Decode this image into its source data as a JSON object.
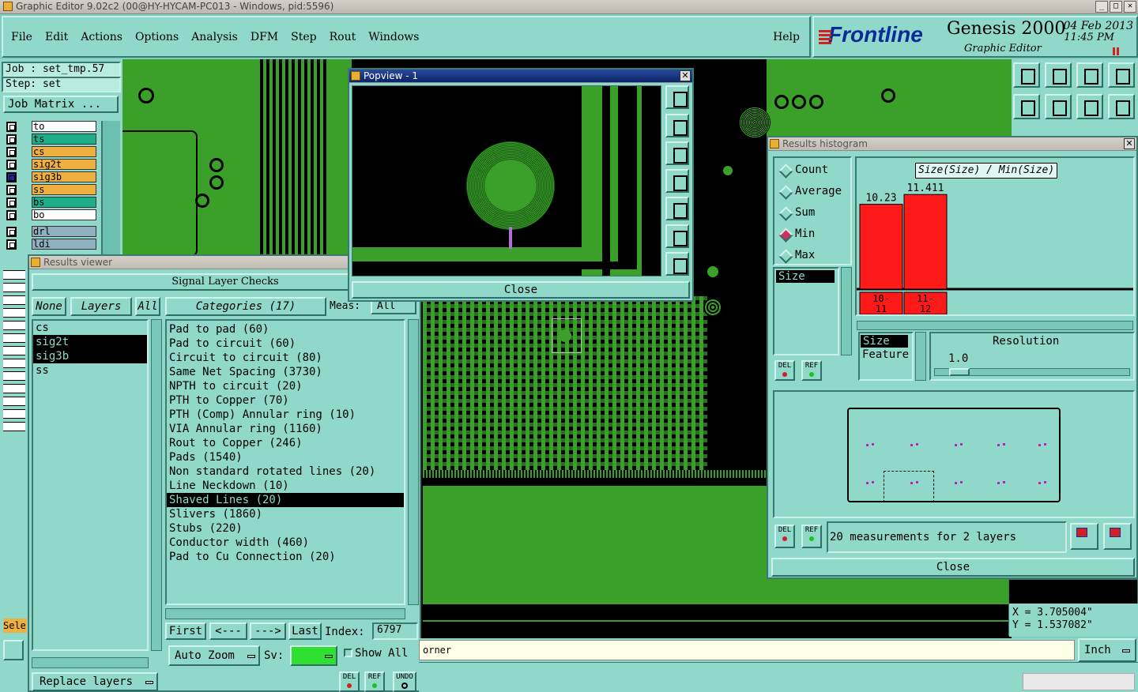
{
  "window": {
    "title": "Graphic Editor 9.02c2 (00@HY-HYCAM-PC013 - Windows, pid:5596)"
  },
  "menu": [
    "File",
    "Edit",
    "Actions",
    "Options",
    "Analysis",
    "DFM",
    "Step",
    "Rout",
    "Windows"
  ],
  "help": "Help",
  "brand": {
    "logo": "Frontline",
    "product": "Genesis 2000",
    "subtitle": "Graphic Editor",
    "date": "04 Feb 2013",
    "time": "11:45 PM"
  },
  "job": {
    "job_line": "Job : set_tmp.57",
    "step_line": "Step: set",
    "matrix_button": "Job Matrix ..."
  },
  "layers": [
    {
      "name": "to",
      "color": "#ffffff"
    },
    {
      "name": "ts",
      "color": "#1fae8a"
    },
    {
      "name": "cs",
      "color": "#f0b040"
    },
    {
      "name": "sig2t",
      "color": "#f0b040"
    },
    {
      "name": "sig3b",
      "color": "#f0b040"
    },
    {
      "name": "ss",
      "color": "#f0b040"
    },
    {
      "name": "bs",
      "color": "#1fae8a"
    },
    {
      "name": "bo",
      "color": "#ffffff"
    },
    {
      "name": "drl",
      "color": "#8fb0c0"
    },
    {
      "name": "ldi",
      "color": "#8fb0c0"
    }
  ],
  "results_viewer": {
    "title": "Results viewer",
    "header": "Signal Layer Checks",
    "none_btn": "None",
    "layers_btn": "Layers",
    "all_btn": "All",
    "layer_list": [
      "cs",
      "sig2t",
      "sig3b",
      "ss"
    ],
    "categories_btn": "Categories (17)",
    "meas_label": "Meas:",
    "meas_value": "All",
    "categories": [
      "Pad to pad (60)",
      "Pad to circuit (60)",
      "Circuit to circuit (80)",
      "Same Net Spacing (3730)",
      "NPTH to circuit (20)",
      "PTH to Copper (70)",
      "PTH (Comp) Annular ring (10)",
      "VIA Annular ring (1160)",
      "Rout to Copper (246)",
      "Pads (1540)",
      "Non standard rotated lines (20)",
      "Line Neckdown (10)",
      "Shaved Lines (20)",
      "Slivers (1860)",
      "Stubs (220)",
      "Conductor width (460)",
      "Pad to Cu Connection (20)"
    ],
    "selected_category": "Shaved Lines (20)",
    "nav": {
      "first": "First",
      "prev": "<---",
      "next": "--->",
      "last": "Last",
      "index_label": "Index:",
      "index_value": "6797"
    },
    "auto_zoom": "Auto Zoom",
    "sv_label": "Sv:",
    "show_all": "Show All",
    "replace_layers": "Replace layers",
    "del": "DEL",
    "ref": "REF",
    "undo": "UNDO"
  },
  "popview": {
    "title": "Popview - 1",
    "close": "Close"
  },
  "histogram": {
    "title": "Results histogram",
    "modes": [
      "Count",
      "Average",
      "Sum",
      "Min",
      "Max"
    ],
    "selected_mode": "Min",
    "chart_label": "Size(Size) / Min(Size)",
    "attr_list": [
      "Size"
    ],
    "resolution_label": "Resolution",
    "resolution_value": "1.0",
    "by_list": [
      "Size",
      "Feature"
    ],
    "summary": "20 measurements for 2 layers",
    "close": "Close",
    "del": "DEL",
    "ref": "REF"
  },
  "chart_data": {
    "type": "bar",
    "categories": [
      "10-11",
      "11-12"
    ],
    "values": [
      10.23,
      11.411
    ],
    "title": "Size(Size) / Min(Size)",
    "ylim": [
      0,
      12
    ]
  },
  "status": {
    "message": "orner",
    "units": "Inch",
    "sel": "Sele",
    "x": "X = 3.705004\"",
    "y": "Y = 1.537082\""
  }
}
